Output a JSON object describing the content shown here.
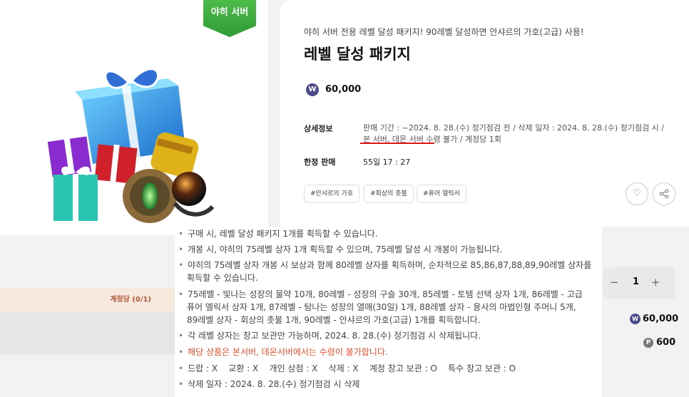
{
  "product": {
    "server_badge": "야히 서버",
    "subtitle": "야히 서버 전용 레벨 달성 패키지! 90레벨 달성하면 안샤르의 가호(고급) 사용!",
    "title": "레벨 달성 패키지",
    "currency_symbol": "W",
    "price": "60,000",
    "detail_label": "상세정보",
    "detail_text": "판매 기간 : ~2024. 8. 28.(수) 정기점검 전 / 삭제 일자 : 2024. 8. 28.(수) 정기점검 시 / 본 서버, 데몬 서버 수령 불가 / 계정당 1회",
    "limit_label": "한정 판매",
    "limit_value": "55일 17 : 27",
    "tags": [
      "#안샤르의 가호",
      "#회상의 촛불",
      "#퓨어 엘릭서"
    ]
  },
  "icons": {
    "wish": "heart-icon",
    "share": "share-icon"
  },
  "description": [
    "구매 시, 레벨 달성 패키지 1개를 획득할 수 있습니다.",
    "개봉 시, 야히의 75레벨 상자 1개 획득할 수 있으며, 75레벨 달성 시 개봉이 가능됩니다.",
    "야히의 75레벨 상자 개봉 시 보상과 함께 80레벨 상자를 획득하며, 순차적으로 85,86,87,88,89,90레벨 상자를",
    "획득할 수 있습니다.",
    "75레벨 - 빛나는 성장의 물약 10개, 80레벨 - 성장의 구슬 30개, 85레벨 - 토템 선택 상자 1개, 86레벨 - 고급",
    "퓨어 엘릭서 상자 1개, 87레벨 - 탐나는 성장의 열매(30일) 1개, 88레벨 상자 - 용사의 마법인형 주머니 5개,",
    "89레벨 상자 - 회상의 촛불 1개, 90레벨 - 안샤르의 가호(고급) 1개를 획득합니다.",
    "각 레벨 상자는 창고 보관만 가능하며, 2024. 8. 28.(수) 정기점검 시 삭제됩니다.",
    "해당 상품은 본서버, 데몬서버에서는 수령이 불가합니다.",
    "드랍 : X    교환 : X    개인 상점 : X    삭제 : X    계정 창고 보관 : O    특수 창고 보관 : O",
    "삭제 일자 : 2024. 8. 28.(수) 정기점검 시 삭제"
  ],
  "purchase": {
    "limit_text": "계정당 (0/1)",
    "quantity": "1",
    "minus": "−",
    "plus": "+",
    "total": "60,000",
    "point_symbol": "P",
    "points": "600"
  },
  "colors": {
    "badge": "#3aa83e",
    "accent_red": "#e4141c",
    "won": "#4d4a8f"
  }
}
